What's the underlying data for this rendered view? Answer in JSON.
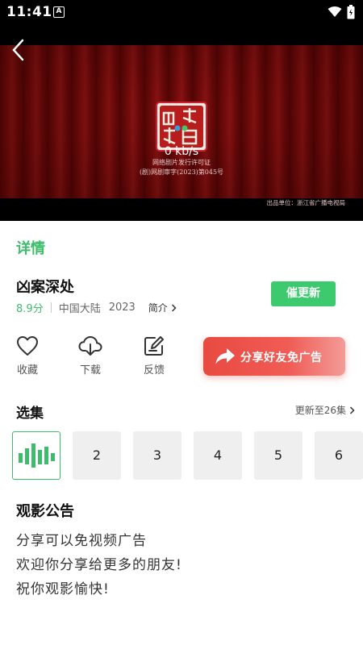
{
  "status_bar": {
    "time": "11:41",
    "indicator": "A",
    "icons": [
      "a-indicator-icon",
      "wifi-icon",
      "battery-icon"
    ]
  },
  "player": {
    "speed": "0 kb/s",
    "license_line1": "网络剧片发行许可证",
    "license_line2": "(剧)网剧审字(2023)第045号",
    "producer": "出品单位：浙江省广播电视局",
    "icons": [
      "back-arrow-icon",
      "logo-seal-icon"
    ]
  },
  "detail": {
    "section_title": "详情",
    "title": "凶案深处",
    "score": "8.9分",
    "region": "中国大陆",
    "year": "2023",
    "intro_label": "简介",
    "update_button": "催更新"
  },
  "actions": {
    "favorite": "收藏",
    "download": "下载",
    "feedback": "反馈",
    "share": "分享好友免广告"
  },
  "episodes": {
    "title": "选集",
    "more": "更新至26集",
    "items": [
      "",
      "2",
      "3",
      "4",
      "5",
      "6"
    ]
  },
  "notice": {
    "title": "观影公告",
    "lines": [
      "分享可以免视频广告",
      "欢迎你分享给更多的朋友!",
      "祝你观影愉快!"
    ]
  },
  "colors": {
    "accent_green": "#3dbd6b",
    "share_red": "#e84a41",
    "curtain": "#7a0c0c"
  }
}
